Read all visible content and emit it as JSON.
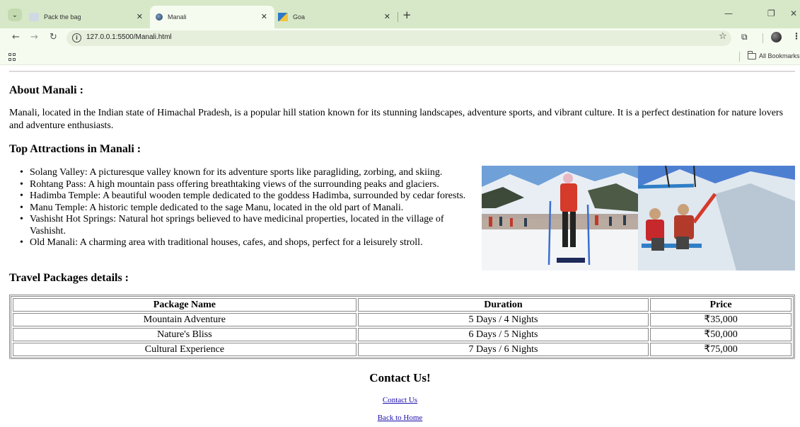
{
  "browser": {
    "tabs": [
      {
        "title": "Pack the bag",
        "icon": "bag-favicon"
      },
      {
        "title": "Manali",
        "icon": "globe-favicon",
        "active": true
      },
      {
        "title": "Goa",
        "icon": "goa-favicon"
      }
    ],
    "url": "127.0.0.1:5500/Manali.html",
    "bookmarks_label": "All Bookmarks"
  },
  "page": {
    "about_heading": "About Manali :",
    "about_text": "Manali, located in the Indian state of Himachal Pradesh, is a popular hill station known for its stunning landscapes, adventure sports, and vibrant culture. It is a perfect destination for nature lovers and adventure enthusiasts.",
    "attractions_heading": "Top Attractions in Manali :",
    "attractions": [
      "Solang Valley: A picturesque valley known for its adventure sports like paragliding, zorbing, and skiing.",
      "Rohtang Pass: A high mountain pass offering breathtaking views of the surrounding peaks and glaciers.",
      "Hadimba Temple: A beautiful wooden temple dedicated to the goddess Hadimba, surrounded by cedar forests.",
      "Manu Temple: A historic temple dedicated to the sage Manu, located in the old part of Manali.",
      "Vashisht Hot Springs: Natural hot springs believed to have medicinal properties, located in the village of Vashisht.",
      "Old Manali: A charming area with traditional houses, cafes, and shops, perfect for a leisurely stroll."
    ],
    "packages_heading": "Travel Packages details :",
    "table": {
      "headers": [
        "Package Name",
        "Duration",
        "Price"
      ],
      "rows": [
        [
          "Mountain Adventure",
          "5 Days / 4 Nights",
          "₹35,000"
        ],
        [
          "Nature's Bliss",
          "6 Days / 5 Nights",
          "₹50,000"
        ],
        [
          "Cultural Experience",
          "7 Days / 6 Nights",
          "₹75,000"
        ]
      ]
    },
    "contact_heading": "Contact Us!",
    "contact_link": "Contact Us",
    "home_link": "Back to Home"
  }
}
